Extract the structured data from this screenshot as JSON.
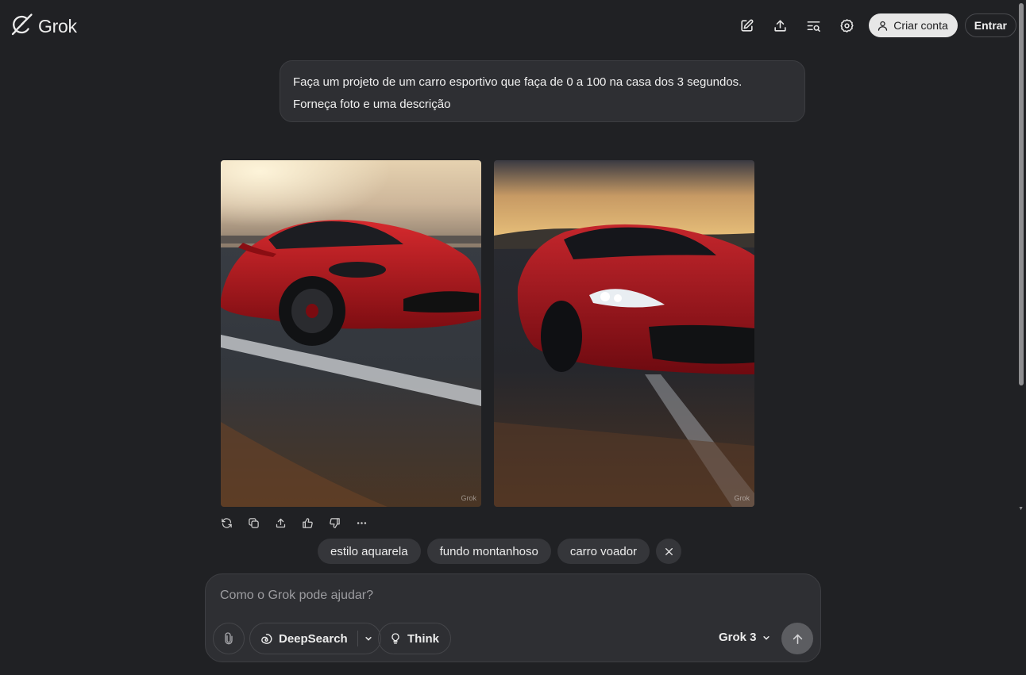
{
  "header": {
    "logo_text": "Grok",
    "icons": [
      "new-chat-icon",
      "share-icon",
      "history-search-icon",
      "settings-icon"
    ],
    "create_account_label": "Criar conta",
    "login_label": "Entrar"
  },
  "conversation": {
    "user_message_line1": "Faça um projeto de um carro esportivo que faça de 0 a 100 na casa dos 3 segundos.",
    "user_message_line2": "Forneça foto e uma descrição",
    "images": [
      {
        "alt": "Carro esportivo vermelho em pista ao pôr do sol",
        "watermark": "Grok"
      },
      {
        "alt": "Carro esportivo vermelho de frente em estrada ao entardecer",
        "watermark": "Grok"
      }
    ],
    "action_icons": [
      "regenerate-icon",
      "copy-icon",
      "share-icon",
      "thumbs-up-icon",
      "thumbs-down-icon",
      "more-icon"
    ]
  },
  "suggestions": {
    "items": [
      "estilo aquarela",
      "fundo montanhoso",
      "carro voador"
    ]
  },
  "composer": {
    "placeholder": "Como o Grok pode ajudar?",
    "deepsearch_label": "DeepSearch",
    "think_label": "Think",
    "model_label": "Grok 3"
  },
  "colors": {
    "background": "#202124",
    "surface": "#2e2f33",
    "chip": "#35363a",
    "accent_car_red": "#b0151d"
  }
}
